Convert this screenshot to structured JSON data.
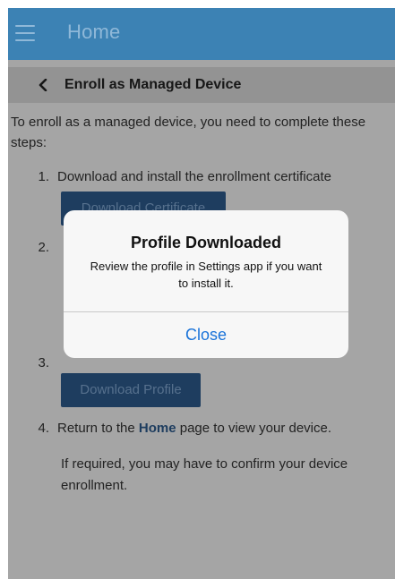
{
  "app_bar": {
    "title": "Home",
    "menu_icon": "hamburger-menu-icon"
  },
  "page": {
    "back_icon": "chevron-left-icon",
    "title": "Enroll as Managed Device"
  },
  "content": {
    "intro": "To enroll as a managed device, you need to complete these steps:",
    "steps": [
      {
        "number": "1.",
        "text": "Download and install the enrollment certificate",
        "button": "Download Certificate"
      },
      {
        "number": "2.",
        "text": ""
      },
      {
        "number": "3.",
        "text": "",
        "button": "Download Profile"
      },
      {
        "number": "4.",
        "text_before": "Return to the ",
        "text_link": "Home",
        "text_after": " page to view your device.",
        "note": "If required, you may have to confirm your device enrollment."
      }
    ]
  },
  "alert": {
    "title": "Profile Downloaded",
    "message": "Review the profile in Settings app if you want to install it.",
    "button": "Close"
  },
  "colors": {
    "app_bar": "#3c82b4",
    "button": "#2d5a8c",
    "alert_action": "#1a73d9"
  }
}
